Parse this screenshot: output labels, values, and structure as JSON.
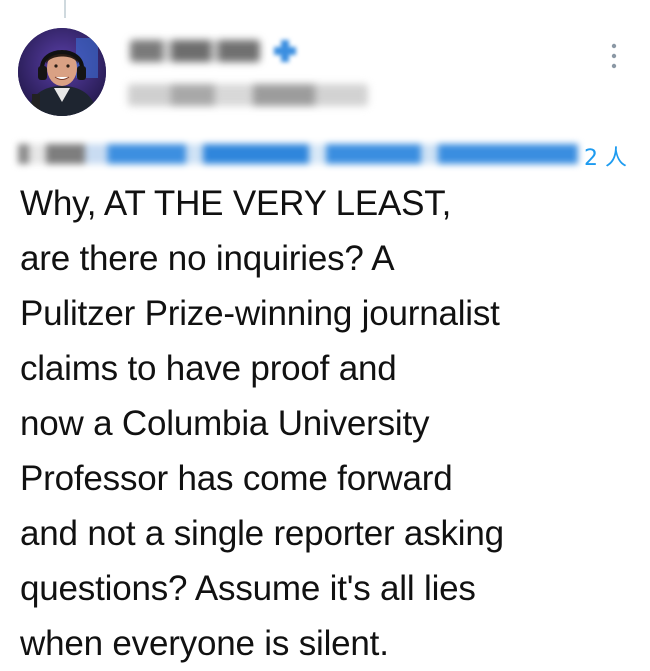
{
  "tweet": {
    "author_avatar": "avatar-icon",
    "more_icon": "more-vertical-icon",
    "verified_icon": "verified-badge-icon",
    "reply_suffix": "2 人",
    "text": "Why, AT THE VERY LEAST,\nare there no inquiries? A\nPulitzer Prize-winning journalist\nclaims to have proof and\nnow a Columbia University\nProfessor has come forward\nand not a single reporter asking\nquestions? Assume it's all lies\nwhen everyone is silent."
  },
  "colors": {
    "accent": "#1d9bf0",
    "text": "#111111",
    "avatar_bg": "#2a1f5c"
  }
}
